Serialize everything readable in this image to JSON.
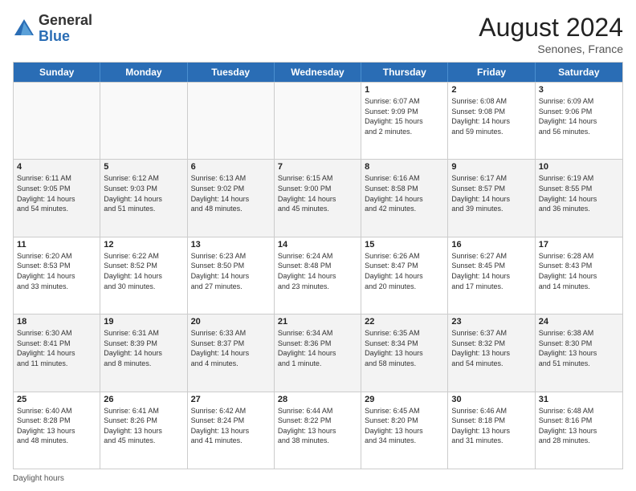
{
  "header": {
    "logo_general": "General",
    "logo_blue": "Blue",
    "month_title": "August 2024",
    "subtitle": "Senones, France"
  },
  "days_of_week": [
    "Sunday",
    "Monday",
    "Tuesday",
    "Wednesday",
    "Thursday",
    "Friday",
    "Saturday"
  ],
  "footer": {
    "label": "Daylight hours"
  },
  "weeks": [
    [
      {
        "day": "",
        "empty": true
      },
      {
        "day": "",
        "empty": true
      },
      {
        "day": "",
        "empty": true
      },
      {
        "day": "",
        "empty": true
      },
      {
        "day": "1",
        "info": "Sunrise: 6:07 AM\nSunset: 9:09 PM\nDaylight: 15 hours\nand 2 minutes."
      },
      {
        "day": "2",
        "info": "Sunrise: 6:08 AM\nSunset: 9:08 PM\nDaylight: 14 hours\nand 59 minutes."
      },
      {
        "day": "3",
        "info": "Sunrise: 6:09 AM\nSunset: 9:06 PM\nDaylight: 14 hours\nand 56 minutes."
      }
    ],
    [
      {
        "day": "4",
        "info": "Sunrise: 6:11 AM\nSunset: 9:05 PM\nDaylight: 14 hours\nand 54 minutes."
      },
      {
        "day": "5",
        "info": "Sunrise: 6:12 AM\nSunset: 9:03 PM\nDaylight: 14 hours\nand 51 minutes."
      },
      {
        "day": "6",
        "info": "Sunrise: 6:13 AM\nSunset: 9:02 PM\nDaylight: 14 hours\nand 48 minutes."
      },
      {
        "day": "7",
        "info": "Sunrise: 6:15 AM\nSunset: 9:00 PM\nDaylight: 14 hours\nand 45 minutes."
      },
      {
        "day": "8",
        "info": "Sunrise: 6:16 AM\nSunset: 8:58 PM\nDaylight: 14 hours\nand 42 minutes."
      },
      {
        "day": "9",
        "info": "Sunrise: 6:17 AM\nSunset: 8:57 PM\nDaylight: 14 hours\nand 39 minutes."
      },
      {
        "day": "10",
        "info": "Sunrise: 6:19 AM\nSunset: 8:55 PM\nDaylight: 14 hours\nand 36 minutes."
      }
    ],
    [
      {
        "day": "11",
        "info": "Sunrise: 6:20 AM\nSunset: 8:53 PM\nDaylight: 14 hours\nand 33 minutes."
      },
      {
        "day": "12",
        "info": "Sunrise: 6:22 AM\nSunset: 8:52 PM\nDaylight: 14 hours\nand 30 minutes."
      },
      {
        "day": "13",
        "info": "Sunrise: 6:23 AM\nSunset: 8:50 PM\nDaylight: 14 hours\nand 27 minutes."
      },
      {
        "day": "14",
        "info": "Sunrise: 6:24 AM\nSunset: 8:48 PM\nDaylight: 14 hours\nand 23 minutes."
      },
      {
        "day": "15",
        "info": "Sunrise: 6:26 AM\nSunset: 8:47 PM\nDaylight: 14 hours\nand 20 minutes."
      },
      {
        "day": "16",
        "info": "Sunrise: 6:27 AM\nSunset: 8:45 PM\nDaylight: 14 hours\nand 17 minutes."
      },
      {
        "day": "17",
        "info": "Sunrise: 6:28 AM\nSunset: 8:43 PM\nDaylight: 14 hours\nand 14 minutes."
      }
    ],
    [
      {
        "day": "18",
        "info": "Sunrise: 6:30 AM\nSunset: 8:41 PM\nDaylight: 14 hours\nand 11 minutes."
      },
      {
        "day": "19",
        "info": "Sunrise: 6:31 AM\nSunset: 8:39 PM\nDaylight: 14 hours\nand 8 minutes."
      },
      {
        "day": "20",
        "info": "Sunrise: 6:33 AM\nSunset: 8:37 PM\nDaylight: 14 hours\nand 4 minutes."
      },
      {
        "day": "21",
        "info": "Sunrise: 6:34 AM\nSunset: 8:36 PM\nDaylight: 14 hours\nand 1 minute."
      },
      {
        "day": "22",
        "info": "Sunrise: 6:35 AM\nSunset: 8:34 PM\nDaylight: 13 hours\nand 58 minutes."
      },
      {
        "day": "23",
        "info": "Sunrise: 6:37 AM\nSunset: 8:32 PM\nDaylight: 13 hours\nand 54 minutes."
      },
      {
        "day": "24",
        "info": "Sunrise: 6:38 AM\nSunset: 8:30 PM\nDaylight: 13 hours\nand 51 minutes."
      }
    ],
    [
      {
        "day": "25",
        "info": "Sunrise: 6:40 AM\nSunset: 8:28 PM\nDaylight: 13 hours\nand 48 minutes."
      },
      {
        "day": "26",
        "info": "Sunrise: 6:41 AM\nSunset: 8:26 PM\nDaylight: 13 hours\nand 45 minutes."
      },
      {
        "day": "27",
        "info": "Sunrise: 6:42 AM\nSunset: 8:24 PM\nDaylight: 13 hours\nand 41 minutes."
      },
      {
        "day": "28",
        "info": "Sunrise: 6:44 AM\nSunset: 8:22 PM\nDaylight: 13 hours\nand 38 minutes."
      },
      {
        "day": "29",
        "info": "Sunrise: 6:45 AM\nSunset: 8:20 PM\nDaylight: 13 hours\nand 34 minutes."
      },
      {
        "day": "30",
        "info": "Sunrise: 6:46 AM\nSunset: 8:18 PM\nDaylight: 13 hours\nand 31 minutes."
      },
      {
        "day": "31",
        "info": "Sunrise: 6:48 AM\nSunset: 8:16 PM\nDaylight: 13 hours\nand 28 minutes."
      }
    ]
  ]
}
